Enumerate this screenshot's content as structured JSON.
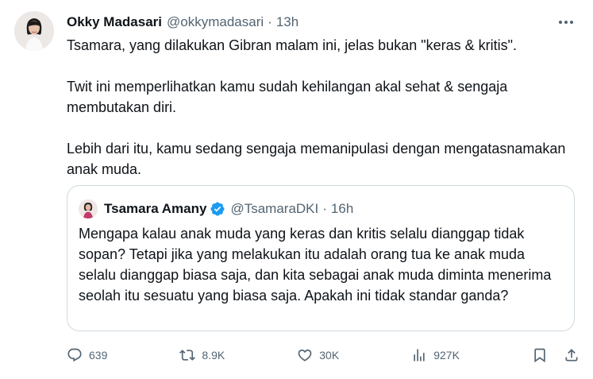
{
  "tweet": {
    "author": {
      "name": "Okky Madasari",
      "handle": "@okkymadasari",
      "separator": "·",
      "time": "13h"
    },
    "paragraphs": [
      "Tsamara, yang dilakukan Gibran malam ini, jelas bukan \"keras & kritis\".",
      "Twit ini memperlihatkan kamu sudah kehilangan akal sehat & sengaja membutakan diri.",
      "Lebih dari itu, kamu sedang sengaja memanipulasi dengan mengatasnamakan anak muda."
    ],
    "quoted": {
      "name": "Tsamara Amany",
      "handle": "@TsamaraDKI",
      "separator": "·",
      "time": "16h",
      "text": "Mengapa kalau anak muda yang keras dan kritis selalu dianggap tidak sopan? Tetapi jika yang melakukan itu adalah orang tua ke anak muda selalu dianggap biasa saja, dan kita sebagai anak muda diminta menerima seolah itu sesuatu yang biasa saja. Apakah ini tidak standar ganda?"
    },
    "actions": {
      "replies": "639",
      "reposts": "8.9K",
      "likes": "30K",
      "views": "927K"
    }
  },
  "icons": {
    "more": "more-horizontal-icon",
    "verified": "verified-badge-icon",
    "reply": "reply-icon",
    "repost": "repost-icon",
    "like": "heart-icon",
    "views": "views-chart-icon",
    "bookmark": "bookmark-icon",
    "share": "share-icon"
  },
  "colors": {
    "text": "#0f1419",
    "secondary": "#536471",
    "border": "#cfd9de",
    "verified": "#1d9bf0"
  }
}
